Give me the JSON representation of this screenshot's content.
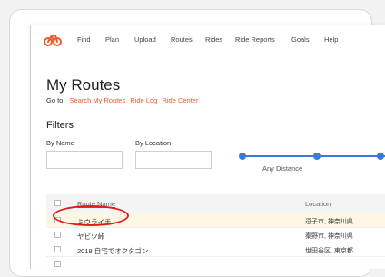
{
  "nav": {
    "logo_icon": "cyclist-logo-icon",
    "accent_color": "#f05a28",
    "items": [
      {
        "label": "Find"
      },
      {
        "label": "Plan"
      },
      {
        "label": "Upload"
      },
      {
        "label": "Routes"
      },
      {
        "label": "Rides"
      },
      {
        "label": "Ride Reports"
      },
      {
        "label": "Goals"
      },
      {
        "label": "Help"
      }
    ]
  },
  "page": {
    "title": "My Routes",
    "goto_label": "Go to:",
    "goto_links": [
      "Search My Routes",
      "Ride Log",
      "Ride Center"
    ]
  },
  "filters": {
    "title": "Filters",
    "by_name_label": "By Name",
    "by_location_label": "By Location",
    "by_name_value": "",
    "by_location_value": "",
    "distance_label": "Any Distance",
    "slider_color": "#3b78d8"
  },
  "table": {
    "headers": {
      "name": "Route Name",
      "location": "Location"
    },
    "rows": [
      {
        "name": "ミウライチ",
        "location": "逗子市, 神奈川県",
        "selected": true
      },
      {
        "name": "ヤビツ峠",
        "location": "秦野市, 神奈川県",
        "selected": false
      },
      {
        "name": "2018 自宅でオクタゴン",
        "location": "世田谷区, 東京都",
        "selected": false
      }
    ]
  },
  "annotation": {
    "highlight_color": "#e21b1b"
  }
}
